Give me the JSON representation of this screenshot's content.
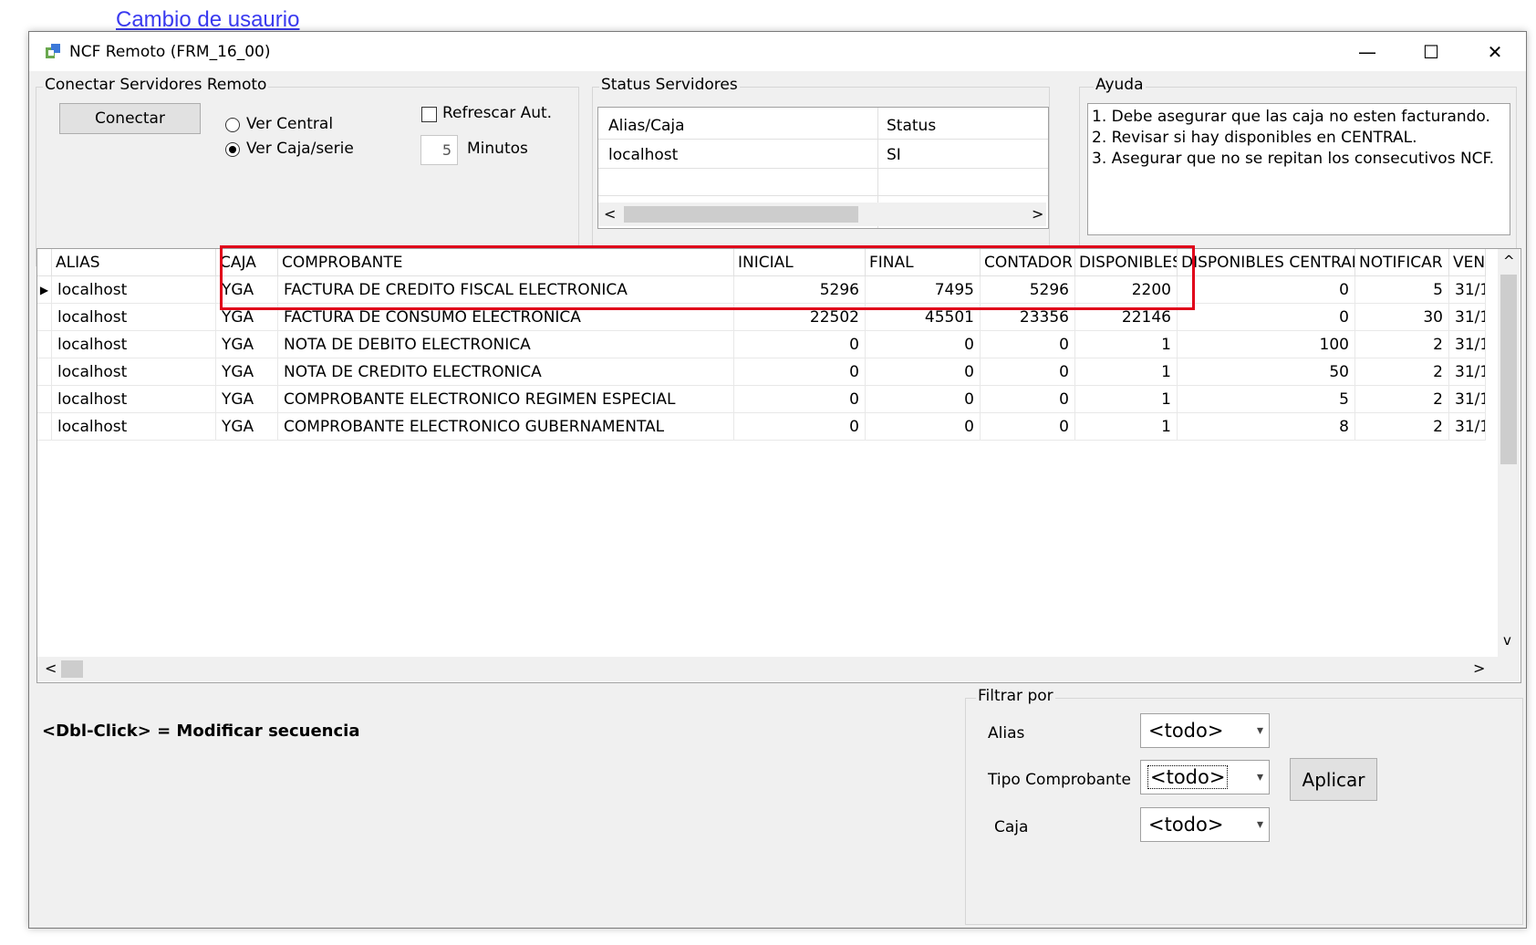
{
  "top_link": "Cambio de usaurio",
  "window": {
    "title": "NCF Remoto (FRM_16_00)",
    "minimize": "—",
    "maximize": "☐",
    "close": "✕"
  },
  "connect_group": {
    "legend": "Conectar Servidores Remoto",
    "connect_button": "Conectar",
    "radio_central": "Ver Central",
    "radio_caja": "Ver Caja/serie",
    "refresh_check": "Refrescar Aut.",
    "minutes_value": "5",
    "minutes_label": "Minutos"
  },
  "status_group": {
    "legend": "Status Servidores",
    "headers": [
      "Alias/Caja",
      "Status"
    ],
    "rows": [
      [
        "localhost",
        "SI"
      ]
    ],
    "scroll_left": "<",
    "scroll_right": ">"
  },
  "help_group": {
    "legend": "Ayuda",
    "lines": [
      "1. Debe asegurar que las caja no esten facturando.",
      "2. Revisar si hay disponibles en CENTRAL.",
      "3. Asegurar que no se repitan los consecutivos NCF."
    ]
  },
  "grid": {
    "headers": [
      "ALIAS",
      "CAJA",
      "COMPROBANTE",
      "INICIAL",
      "FINAL",
      "CONTADOR",
      "DISPONIBLES",
      "DISPONIBLES CENTRAL",
      "NOTIFICAR",
      "VEN"
    ],
    "rows": [
      [
        "localhost",
        "YGA",
        "FACTURA DE CREDITO FISCAL ELECTRONICA",
        "5296",
        "7495",
        "5296",
        "2200",
        "0",
        "5",
        "31/1"
      ],
      [
        "localhost",
        "YGA",
        "FACTURA DE CONSUMO ELECTRONICA",
        "22502",
        "45501",
        "23356",
        "22146",
        "0",
        "30",
        "31/1"
      ],
      [
        "localhost",
        "YGA",
        "NOTA DE DEBITO ELECTRONICA",
        "0",
        "0",
        "0",
        "1",
        "100",
        "2",
        "31/1"
      ],
      [
        "localhost",
        "YGA",
        "NOTA DE CREDITO ELECTRONICA",
        "0",
        "0",
        "0",
        "1",
        "50",
        "2",
        "31/1"
      ],
      [
        "localhost",
        "YGA",
        "COMPROBANTE ELECTRONICO REGIMEN ESPECIAL",
        "0",
        "0",
        "0",
        "1",
        "5",
        "2",
        "31/1"
      ],
      [
        "localhost",
        "YGA",
        "COMPROBANTE ELECTRONICO GUBERNAMENTAL",
        "0",
        "0",
        "0",
        "1",
        "8",
        "2",
        "31/1"
      ]
    ],
    "current_row_marker": "▶",
    "scroll_up": "^",
    "scroll_down": "v",
    "scroll_left": "<",
    "scroll_right": ">"
  },
  "hint": "<Dbl-Click> = Modificar secuencia",
  "filter": {
    "legend": "Filtrar por",
    "alias_label": "Alias",
    "alias_value": "<todo>",
    "tipo_label": "Tipo Comprobante",
    "tipo_value": "<todo>",
    "caja_label": "Caja",
    "caja_value": "<todo>",
    "apply_button": "Aplicar"
  },
  "colors": {
    "highlight": "#e0001a",
    "link": "#3a3af0",
    "window_bg": "#f0f0f0"
  }
}
